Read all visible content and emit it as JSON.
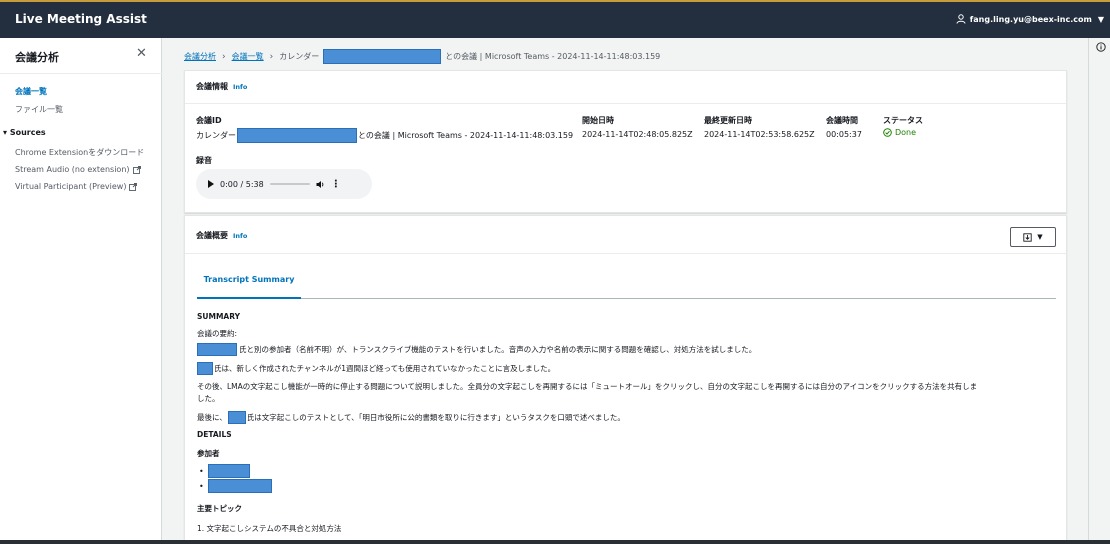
{
  "app": {
    "title": "Live Meeting Assist",
    "user": "fang.ling.yu@beex-inc.com"
  },
  "sidebar": {
    "header": "会議分析",
    "nav": [
      {
        "label": "会議一覧"
      },
      {
        "label": "ファイル一覧"
      }
    ],
    "section": "Sources",
    "source_items": [
      {
        "label": "Chrome Extensionをダウンロード"
      },
      {
        "label": "Stream Audio (no extension)"
      },
      {
        "label": "Virtual Participant (Preview)"
      }
    ]
  },
  "breadcrumb": {
    "root": "会議分析",
    "list": "会議一覧",
    "current_prefix": "カレンダー",
    "current_suffix": "との会議 | Microsoft Teams - 2024-11-14-11:48:03.159"
  },
  "meeting_info": {
    "title": "会議情報",
    "info_link": "Info",
    "fields": {
      "id_label": "会議ID",
      "id_prefix": "カレンダー",
      "id_suffix": "との会議 | Microsoft Teams - 2024-11-14-11:48:03.159",
      "start_label": "開始日時",
      "start_value": "2024-11-14T02:48:05.825Z",
      "updated_label": "最終更新日時",
      "updated_value": "2024-11-14T02:53:58.625Z",
      "duration_label": "会議時間",
      "duration_value": "00:05:37",
      "status_label": "ステータス",
      "status_value": "Done"
    },
    "recording_label": "録音",
    "audio_time": "0:00 / 5:38"
  },
  "summary_panel": {
    "title": "会議概要",
    "info_link": "Info",
    "tab": "Transcript Summary",
    "heading": "SUMMARY",
    "intro": "会議の要約:",
    "p1": "氏と別の参加者（名前不明）が、トランスクライブ機能のテストを行いました。音声の入力や名前の表示に関する問題を確認し、対処方法を試しました。",
    "p2": "氏は、新しく作成されたチャンネルが1週間ほど経っても使用されていなかったことに言及しました。",
    "p3a": "その後、LMAの文字起こし機能が一時的に停止する問題について説明しました。全員分の文字起こしを再開するには「ミュートオール」をクリックし、自分の文字起こしを再開するには自分のアイコンをクリックする方法を共有しま",
    "p3b": "した。",
    "p4a": "最後に、",
    "p4b": "氏は文字起こしのテストとして、「明日市役所に公的書類を取りに行きます」というタスクを口頭で述べました。",
    "details": "DETAILS",
    "participants": "参加者",
    "topics": "主要トピック",
    "topic1": "1. 文字起こしシステムの不具合と対処方法"
  },
  "colors": {
    "accent": "#0073bb",
    "header_bg": "#232f3e",
    "success": "#1d8102",
    "redaction": "#4a8ed6"
  }
}
